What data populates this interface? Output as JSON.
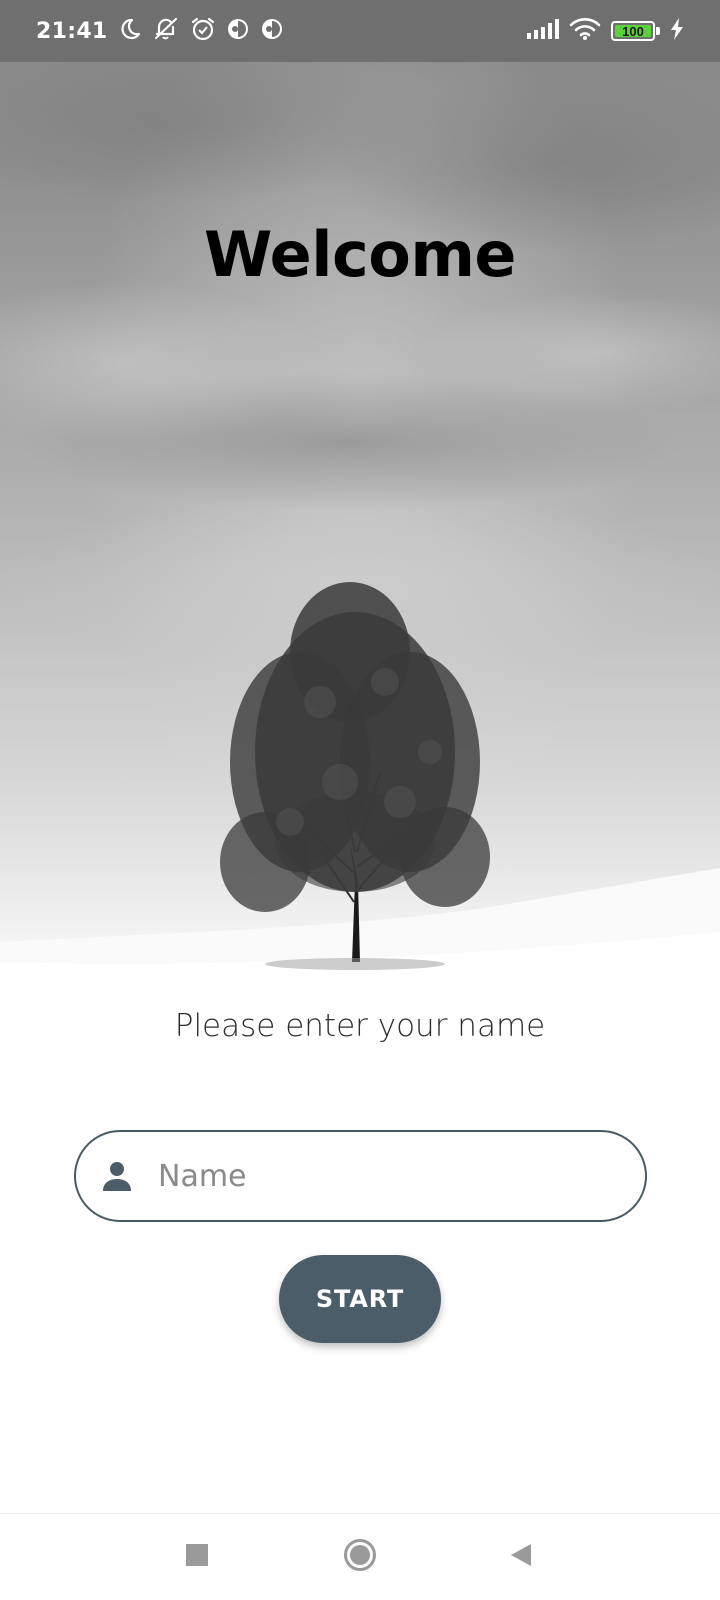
{
  "status_bar": {
    "time": "21:41",
    "icons": [
      "moon-icon",
      "notifications-off-icon",
      "alarm-icon",
      "app-indicator-icon",
      "app-indicator-icon",
      "signal-icon",
      "wifi-icon",
      "battery-icon",
      "charging-icon"
    ],
    "battery_level": "100",
    "battery_color": "#5bd23b"
  },
  "hero": {
    "title": "Welcome"
  },
  "form": {
    "prompt": "Please enter your name",
    "name_placeholder": "Name",
    "name_value": "",
    "start_label": "START",
    "accent_color": "#4a5d69"
  },
  "nav_bar": {
    "buttons": [
      "recent-apps",
      "home",
      "back"
    ]
  }
}
